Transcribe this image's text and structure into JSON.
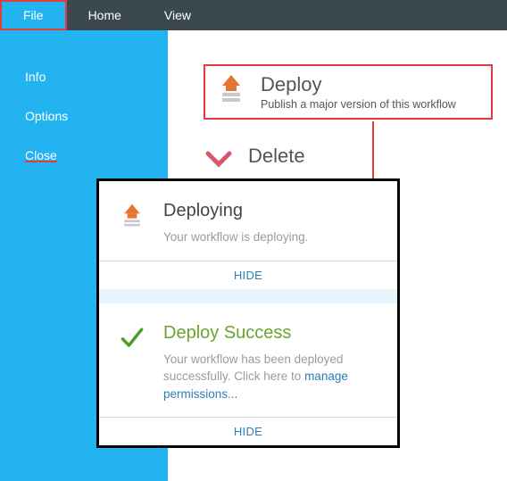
{
  "tabs": {
    "file": "File",
    "home": "Home",
    "view": "View"
  },
  "sidebar": {
    "info": "Info",
    "options": "Options",
    "close": "Close"
  },
  "deploy": {
    "title": "Deploy",
    "sub": "Publish a major version of this workflow"
  },
  "delete": {
    "title": "Delete"
  },
  "dialog1": {
    "title": "Deploying",
    "msg": "Your workflow is deploying.",
    "hide": "HIDE"
  },
  "dialog2": {
    "title": "Deploy Success",
    "msg_pre": "Your workflow has been deployed successfully. Click here to ",
    "link": "manage permissions...",
    "hide": "HIDE"
  }
}
